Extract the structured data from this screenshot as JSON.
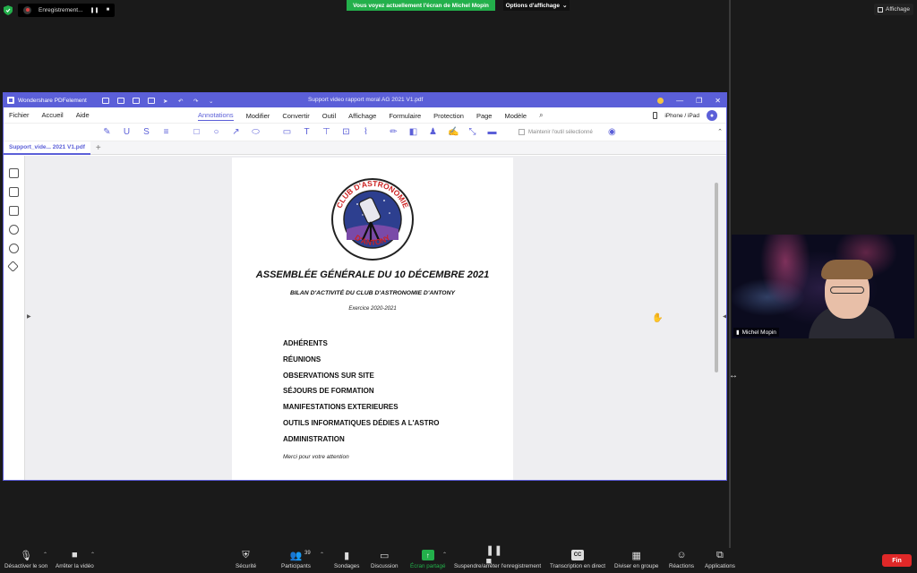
{
  "zoom_top": {
    "recording_label": "Enregistrement...",
    "pause_symbol": "❚❚",
    "stop_symbol": "■",
    "share_banner": "Vous voyez actuellement l'écran de Michel Mopin",
    "view_options": "Options d'affichage",
    "view_options_caret": "⌄",
    "affichage": "Affichage"
  },
  "pdf_app": {
    "app_name": "Wondershare PDFelement",
    "doc_title": "Support video rapport moral AG 2021 V1.pdf",
    "menu_left": [
      "Fichier",
      "Accueil",
      "Aide"
    ],
    "menu_main": [
      "Annotations",
      "Modifier",
      "Convertir",
      "Outil",
      "Affichage",
      "Formulaire",
      "Protection",
      "Page",
      "Modèle"
    ],
    "active_menu": "Annotations",
    "device_label": "iPhone / iPad",
    "keep_tool_label": "Maintenir l'outil sélectionné",
    "tab_name": "Support_vide... 2021 V1.pdf",
    "tab_plus": "+"
  },
  "document": {
    "logo_top": "CLUB D'ASTRONOMIE",
    "logo_bottom": "D'ANTONY",
    "title": "ASSEMBLÉE GÉNÉRALE DU 10 DÉCEMBRE 2021",
    "subtitle": "BILAN D'ACTIVITÉ DU CLUB D'ASTRONOMIE D'ANTONY",
    "exercise": "Exercice 2020-2021",
    "items": [
      "ADHÉRENTS",
      "RÉUNIONS",
      "OBSERVATIONS SUR SITE",
      "SÉJOURS DE FORMATION",
      "MANIFESTATIONS EXTERIEURES",
      "OUTILS INFORMATIQUES DÉDIES A L'ASTRO",
      "ADMINISTRATION"
    ],
    "closing": "Merci pour votre attention"
  },
  "video": {
    "participant_name": "Michel Mopin"
  },
  "bottom_bar": {
    "mute": "Désactiver le son",
    "video": "Arrêter la vidéo",
    "security": "Sécurité",
    "participants": "Participants",
    "participants_count": "39",
    "polls": "Sondages",
    "chat": "Discussion",
    "share": "Écran partagé",
    "record": "Suspendre/arrêter l'enregistrement",
    "transcription": "Transcription en direct",
    "breakout": "Diviser en groupe",
    "reactions": "Réactions",
    "apps": "Applications",
    "end": "Fin",
    "cc_symbol": "CC"
  },
  "colors": {
    "accent": "#5b5fd8",
    "zoom_green": "#23b04b",
    "end_red": "#e02828"
  }
}
